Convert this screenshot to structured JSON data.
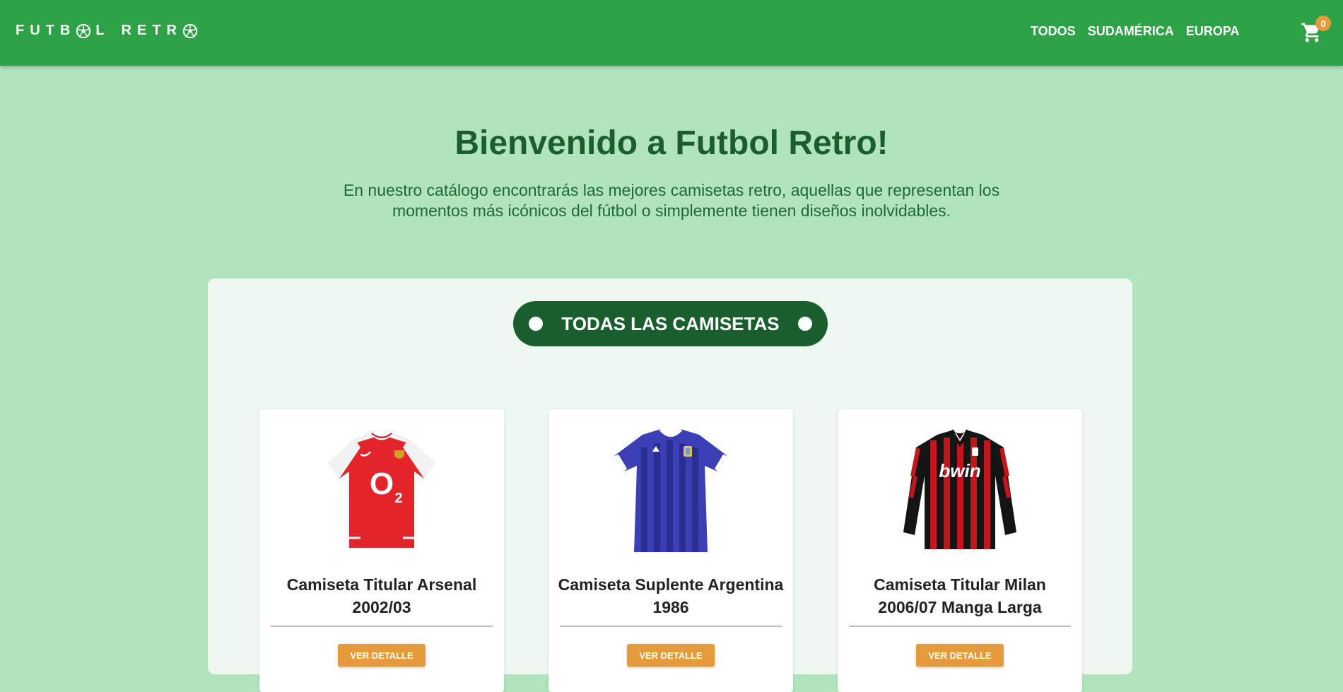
{
  "brand": {
    "logo_letters_1": "FUTB",
    "logo_letters_2": "L",
    "logo_letters_3": "RETR"
  },
  "nav": {
    "links": [
      "TODOS",
      "SUDAMÉRICA",
      "EUROPA"
    ]
  },
  "cart": {
    "count": "0",
    "icon": "cart-icon"
  },
  "hero": {
    "title": "Bienvenido a Futbol Retro!",
    "text": "En nuestro catálogo encontrarás las mejores camisetas retro, aquellas que representan los momentos más icónicos del fútbol o simplemente tienen diseños inolvidables."
  },
  "catalog": {
    "section_title": "TODAS LAS CAMISETAS",
    "products": [
      {
        "title": "Camiseta Titular Arsenal 2002/03",
        "button": "VER DETALLE",
        "image": "arsenal-shirt",
        "shirt_text": "O",
        "shirt_sub": "2"
      },
      {
        "title": "Camiseta Suplente Argentina 1986",
        "button": "VER DETALLE",
        "image": "argentina-shirt"
      },
      {
        "title": "Camiseta Titular Milan 2006/07 Manga Larga",
        "button": "VER DETALLE",
        "image": "milan-shirt",
        "shirt_text": "bwin"
      }
    ]
  },
  "colors": {
    "header": "#2ea246",
    "page_bg": "#b1e3bd",
    "dark_green": "#1b5e2e",
    "accent": "#e79a3a"
  }
}
